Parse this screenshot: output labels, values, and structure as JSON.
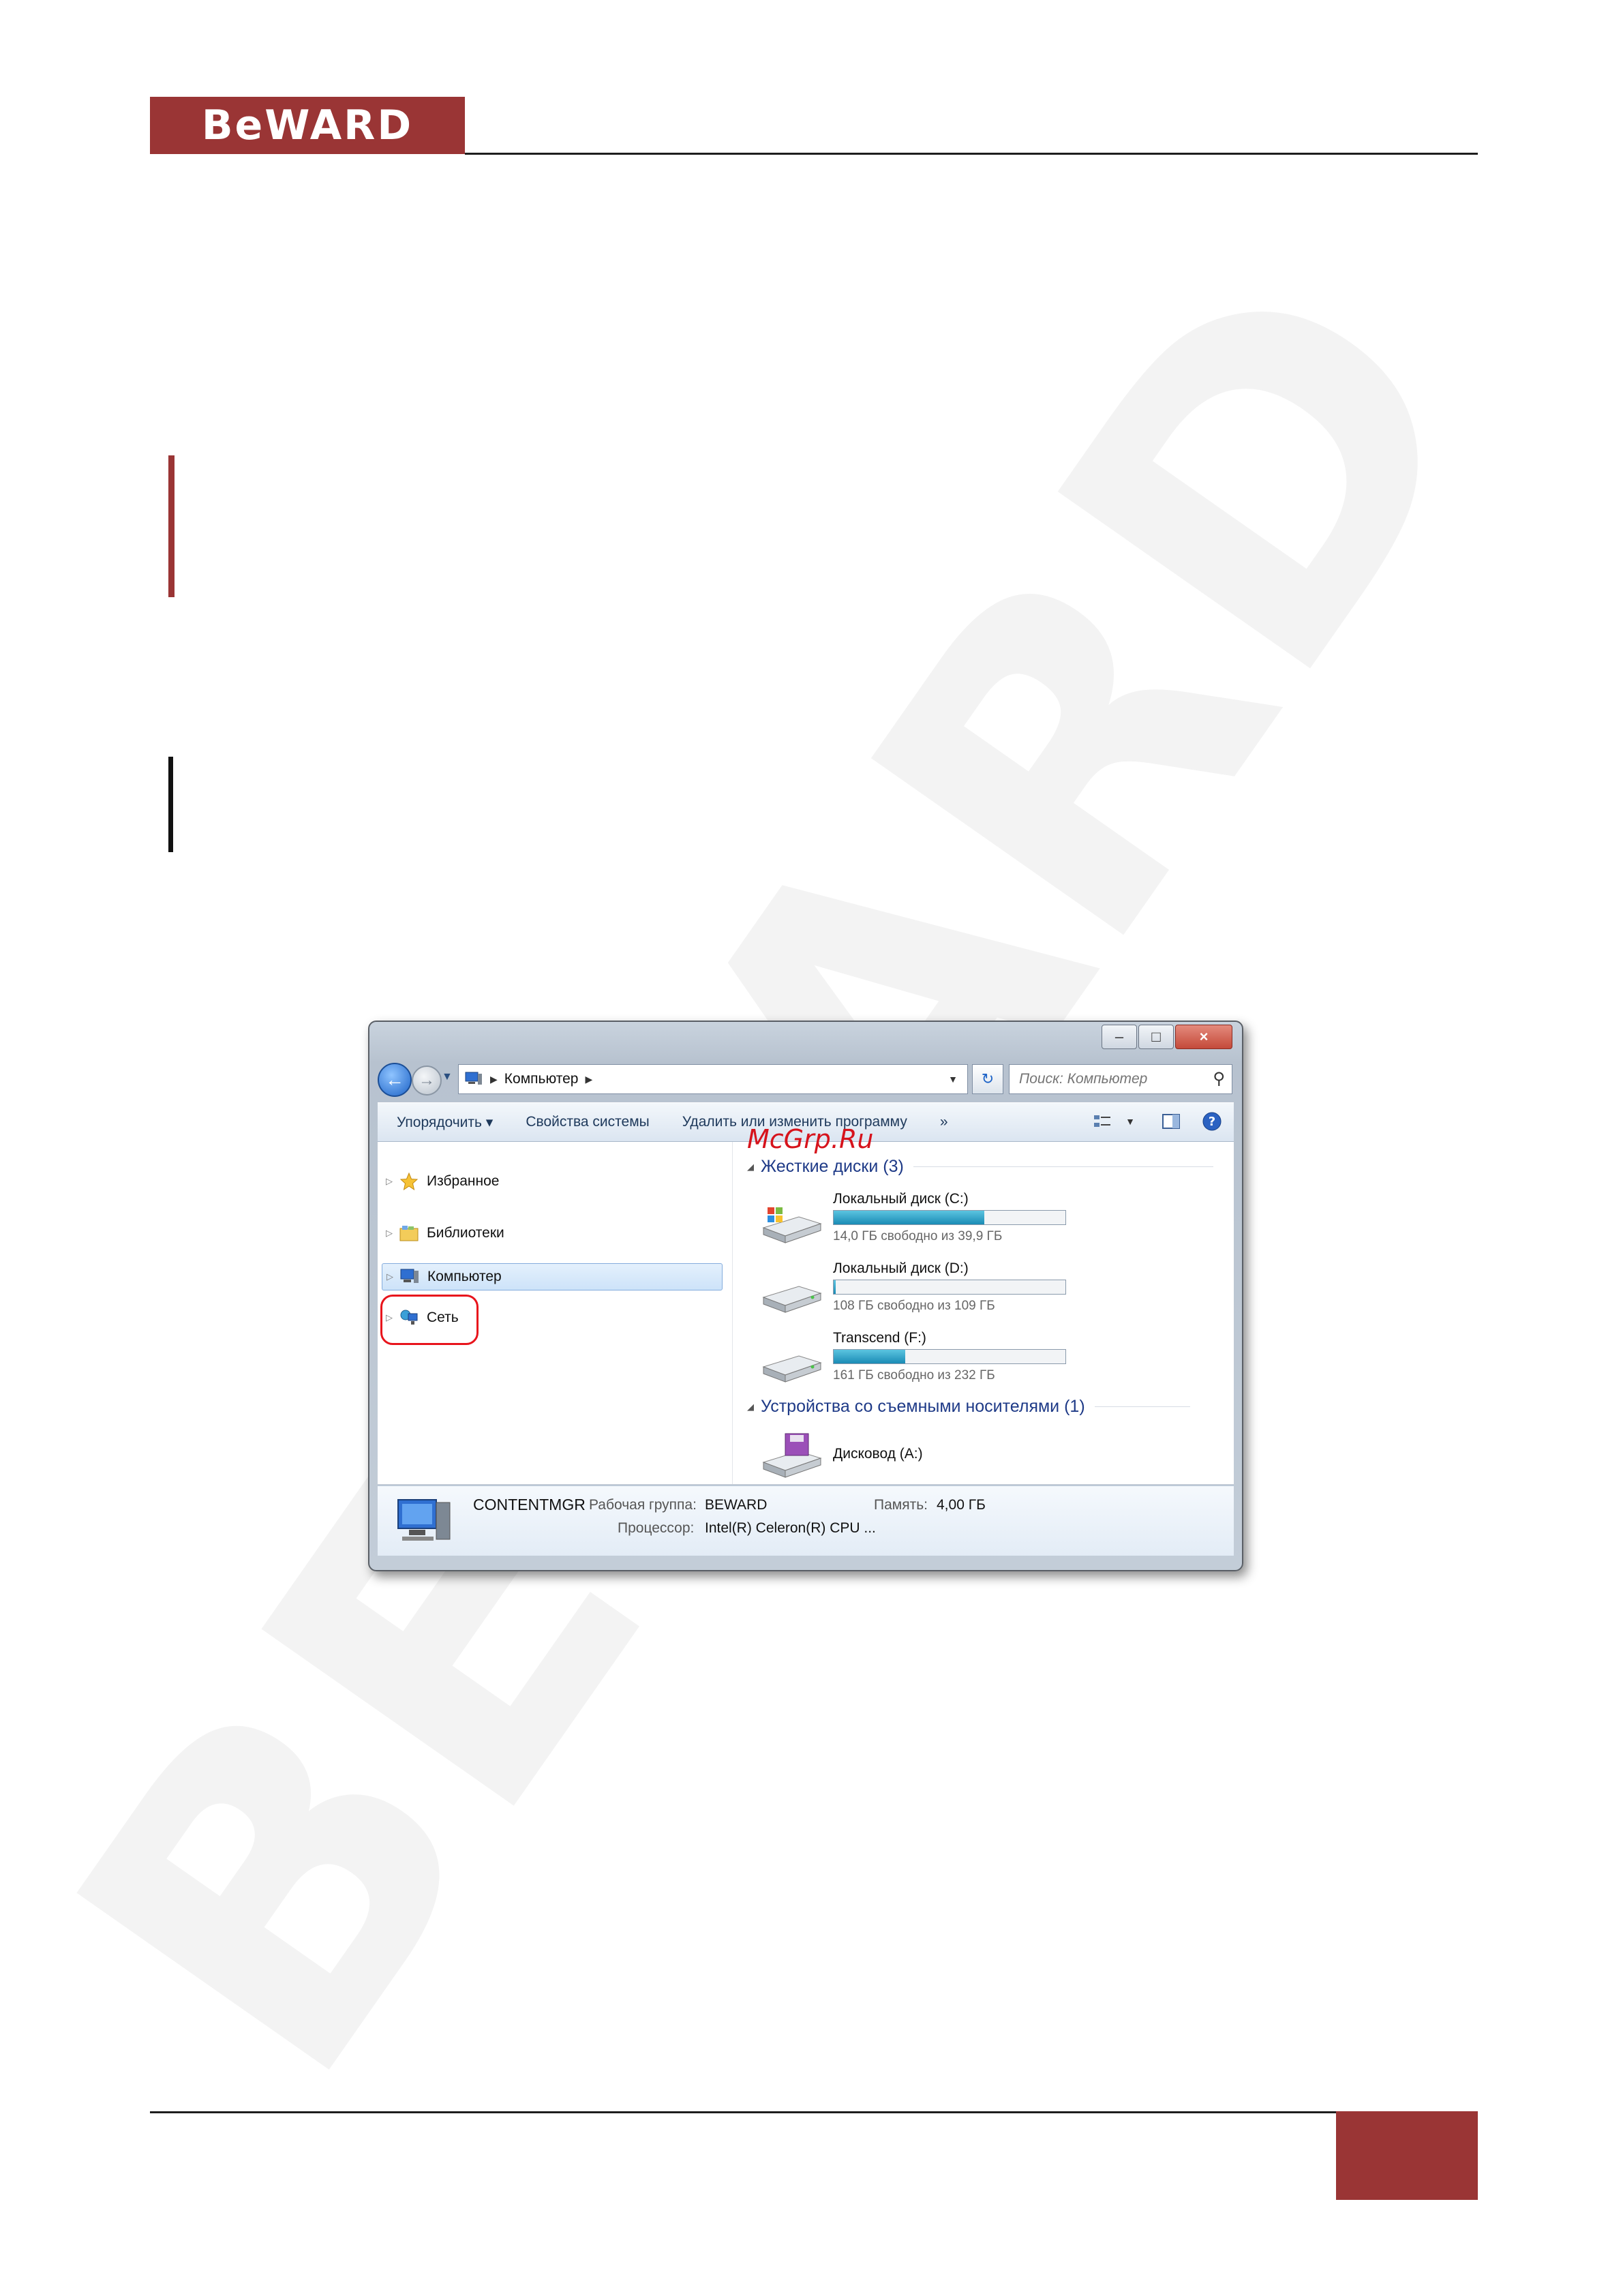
{
  "page": {
    "logo_text": "BeWARD",
    "watermark_text": "BEWARD"
  },
  "window": {
    "title_buttons": {
      "minimize": "–",
      "maximize": "□",
      "close": "×"
    },
    "address": {
      "location": "Компьютер"
    },
    "search": {
      "placeholder": "Поиск: Компьютер"
    },
    "toolbar": {
      "organize": "Упорядочить",
      "system_properties": "Свойства системы",
      "uninstall": "Удалить или изменить программу",
      "more": "»"
    },
    "nav": {
      "favorites": "Избранное",
      "libraries": "Библиотеки",
      "computer": "Компьютер",
      "network": "Сеть"
    },
    "main": {
      "overlay_watermark": "McGrp.Ru",
      "hard_drives_header": "Жесткие диски (3)",
      "removable_header": "Устройства со съемными носителями (1)",
      "drives": [
        {
          "name": "Локальный диск (C:)",
          "free": "14,0 ГБ свободно из 39,9 ГБ",
          "used_fraction": 0.65,
          "icon": "windows-drive-icon"
        },
        {
          "name": "Локальный диск (D:)",
          "free": "108 ГБ свободно из 109 ГБ",
          "used_fraction": 0.01,
          "icon": "hard-drive-icon"
        },
        {
          "name": "Transcend (F:)",
          "free": "161 ГБ свободно из 232 ГБ",
          "used_fraction": 0.31,
          "icon": "hard-drive-icon"
        }
      ],
      "removable": [
        {
          "name": "Дисковод (A:)",
          "icon": "floppy-drive-icon"
        }
      ]
    },
    "details": {
      "computer_name": "CONTENTMGR",
      "workgroup_label": "Рабочая группа:",
      "workgroup_value": "BEWARD",
      "memory_label": "Память:",
      "memory_value": "4,00 ГБ",
      "cpu_label": "Процессор:",
      "cpu_value": "Intel(R) Celeron(R) CPU ..."
    }
  },
  "colors": {
    "brand": "#9a3535",
    "highlight_ring": "#e8141c",
    "group_header": "#1e3a87"
  }
}
